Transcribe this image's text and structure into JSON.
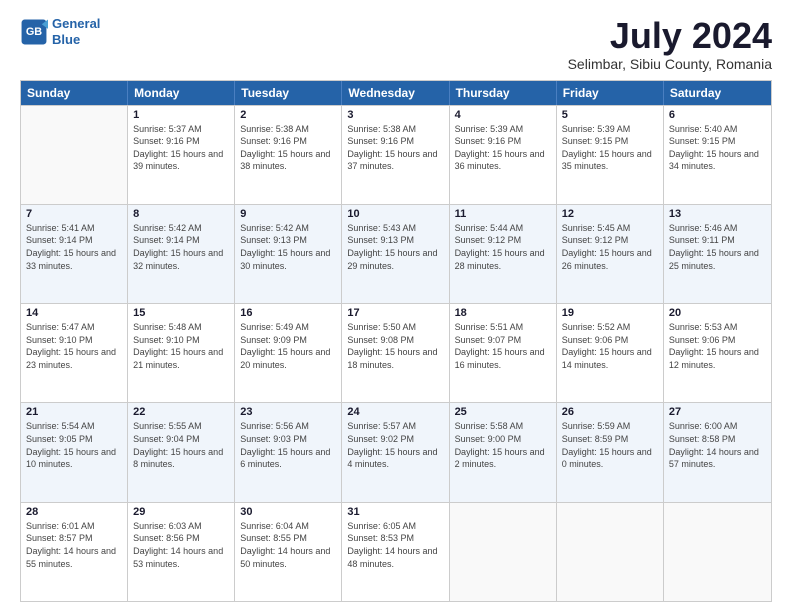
{
  "header": {
    "logo": {
      "line1": "General",
      "line2": "Blue"
    },
    "title": "July 2024",
    "subtitle": "Selimbar, Sibiu County, Romania"
  },
  "weekdays": [
    "Sunday",
    "Monday",
    "Tuesday",
    "Wednesday",
    "Thursday",
    "Friday",
    "Saturday"
  ],
  "weeks": [
    [
      {
        "day": "",
        "sunrise": "",
        "sunset": "",
        "daylight": ""
      },
      {
        "day": "1",
        "sunrise": "Sunrise: 5:37 AM",
        "sunset": "Sunset: 9:16 PM",
        "daylight": "Daylight: 15 hours and 39 minutes."
      },
      {
        "day": "2",
        "sunrise": "Sunrise: 5:38 AM",
        "sunset": "Sunset: 9:16 PM",
        "daylight": "Daylight: 15 hours and 38 minutes."
      },
      {
        "day": "3",
        "sunrise": "Sunrise: 5:38 AM",
        "sunset": "Sunset: 9:16 PM",
        "daylight": "Daylight: 15 hours and 37 minutes."
      },
      {
        "day": "4",
        "sunrise": "Sunrise: 5:39 AM",
        "sunset": "Sunset: 9:16 PM",
        "daylight": "Daylight: 15 hours and 36 minutes."
      },
      {
        "day": "5",
        "sunrise": "Sunrise: 5:39 AM",
        "sunset": "Sunset: 9:15 PM",
        "daylight": "Daylight: 15 hours and 35 minutes."
      },
      {
        "day": "6",
        "sunrise": "Sunrise: 5:40 AM",
        "sunset": "Sunset: 9:15 PM",
        "daylight": "Daylight: 15 hours and 34 minutes."
      }
    ],
    [
      {
        "day": "7",
        "sunrise": "Sunrise: 5:41 AM",
        "sunset": "Sunset: 9:14 PM",
        "daylight": "Daylight: 15 hours and 33 minutes."
      },
      {
        "day": "8",
        "sunrise": "Sunrise: 5:42 AM",
        "sunset": "Sunset: 9:14 PM",
        "daylight": "Daylight: 15 hours and 32 minutes."
      },
      {
        "day": "9",
        "sunrise": "Sunrise: 5:42 AM",
        "sunset": "Sunset: 9:13 PM",
        "daylight": "Daylight: 15 hours and 30 minutes."
      },
      {
        "day": "10",
        "sunrise": "Sunrise: 5:43 AM",
        "sunset": "Sunset: 9:13 PM",
        "daylight": "Daylight: 15 hours and 29 minutes."
      },
      {
        "day": "11",
        "sunrise": "Sunrise: 5:44 AM",
        "sunset": "Sunset: 9:12 PM",
        "daylight": "Daylight: 15 hours and 28 minutes."
      },
      {
        "day": "12",
        "sunrise": "Sunrise: 5:45 AM",
        "sunset": "Sunset: 9:12 PM",
        "daylight": "Daylight: 15 hours and 26 minutes."
      },
      {
        "day": "13",
        "sunrise": "Sunrise: 5:46 AM",
        "sunset": "Sunset: 9:11 PM",
        "daylight": "Daylight: 15 hours and 25 minutes."
      }
    ],
    [
      {
        "day": "14",
        "sunrise": "Sunrise: 5:47 AM",
        "sunset": "Sunset: 9:10 PM",
        "daylight": "Daylight: 15 hours and 23 minutes."
      },
      {
        "day": "15",
        "sunrise": "Sunrise: 5:48 AM",
        "sunset": "Sunset: 9:10 PM",
        "daylight": "Daylight: 15 hours and 21 minutes."
      },
      {
        "day": "16",
        "sunrise": "Sunrise: 5:49 AM",
        "sunset": "Sunset: 9:09 PM",
        "daylight": "Daylight: 15 hours and 20 minutes."
      },
      {
        "day": "17",
        "sunrise": "Sunrise: 5:50 AM",
        "sunset": "Sunset: 9:08 PM",
        "daylight": "Daylight: 15 hours and 18 minutes."
      },
      {
        "day": "18",
        "sunrise": "Sunrise: 5:51 AM",
        "sunset": "Sunset: 9:07 PM",
        "daylight": "Daylight: 15 hours and 16 minutes."
      },
      {
        "day": "19",
        "sunrise": "Sunrise: 5:52 AM",
        "sunset": "Sunset: 9:06 PM",
        "daylight": "Daylight: 15 hours and 14 minutes."
      },
      {
        "day": "20",
        "sunrise": "Sunrise: 5:53 AM",
        "sunset": "Sunset: 9:06 PM",
        "daylight": "Daylight: 15 hours and 12 minutes."
      }
    ],
    [
      {
        "day": "21",
        "sunrise": "Sunrise: 5:54 AM",
        "sunset": "Sunset: 9:05 PM",
        "daylight": "Daylight: 15 hours and 10 minutes."
      },
      {
        "day": "22",
        "sunrise": "Sunrise: 5:55 AM",
        "sunset": "Sunset: 9:04 PM",
        "daylight": "Daylight: 15 hours and 8 minutes."
      },
      {
        "day": "23",
        "sunrise": "Sunrise: 5:56 AM",
        "sunset": "Sunset: 9:03 PM",
        "daylight": "Daylight: 15 hours and 6 minutes."
      },
      {
        "day": "24",
        "sunrise": "Sunrise: 5:57 AM",
        "sunset": "Sunset: 9:02 PM",
        "daylight": "Daylight: 15 hours and 4 minutes."
      },
      {
        "day": "25",
        "sunrise": "Sunrise: 5:58 AM",
        "sunset": "Sunset: 9:00 PM",
        "daylight": "Daylight: 15 hours and 2 minutes."
      },
      {
        "day": "26",
        "sunrise": "Sunrise: 5:59 AM",
        "sunset": "Sunset: 8:59 PM",
        "daylight": "Daylight: 15 hours and 0 minutes."
      },
      {
        "day": "27",
        "sunrise": "Sunrise: 6:00 AM",
        "sunset": "Sunset: 8:58 PM",
        "daylight": "Daylight: 14 hours and 57 minutes."
      }
    ],
    [
      {
        "day": "28",
        "sunrise": "Sunrise: 6:01 AM",
        "sunset": "Sunset: 8:57 PM",
        "daylight": "Daylight: 14 hours and 55 minutes."
      },
      {
        "day": "29",
        "sunrise": "Sunrise: 6:03 AM",
        "sunset": "Sunset: 8:56 PM",
        "daylight": "Daylight: 14 hours and 53 minutes."
      },
      {
        "day": "30",
        "sunrise": "Sunrise: 6:04 AM",
        "sunset": "Sunset: 8:55 PM",
        "daylight": "Daylight: 14 hours and 50 minutes."
      },
      {
        "day": "31",
        "sunrise": "Sunrise: 6:05 AM",
        "sunset": "Sunset: 8:53 PM",
        "daylight": "Daylight: 14 hours and 48 minutes."
      },
      {
        "day": "",
        "sunrise": "",
        "sunset": "",
        "daylight": ""
      },
      {
        "day": "",
        "sunrise": "",
        "sunset": "",
        "daylight": ""
      },
      {
        "day": "",
        "sunrise": "",
        "sunset": "",
        "daylight": ""
      }
    ]
  ]
}
